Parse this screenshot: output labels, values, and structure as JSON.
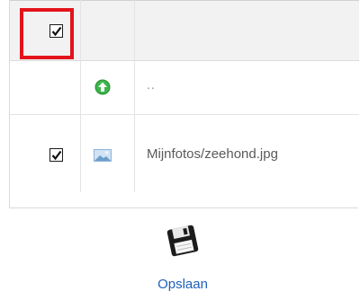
{
  "table": {
    "header": {
      "select_all_checked": true
    },
    "rows": [
      {
        "type": "parent",
        "icon": "up-arrow-icon",
        "label": ".."
      },
      {
        "type": "file",
        "icon": "image-file-icon",
        "checked": true,
        "label": "Mijnfotos/zeehond.jpg"
      }
    ]
  },
  "save_button": {
    "label": "Opslaan",
    "icon": "floppy-disk-icon"
  },
  "colors": {
    "highlight": "#e3141b",
    "link": "#2060b8",
    "header_bg": "#f2f2f2",
    "up_icon_green": "#3bb54a"
  }
}
